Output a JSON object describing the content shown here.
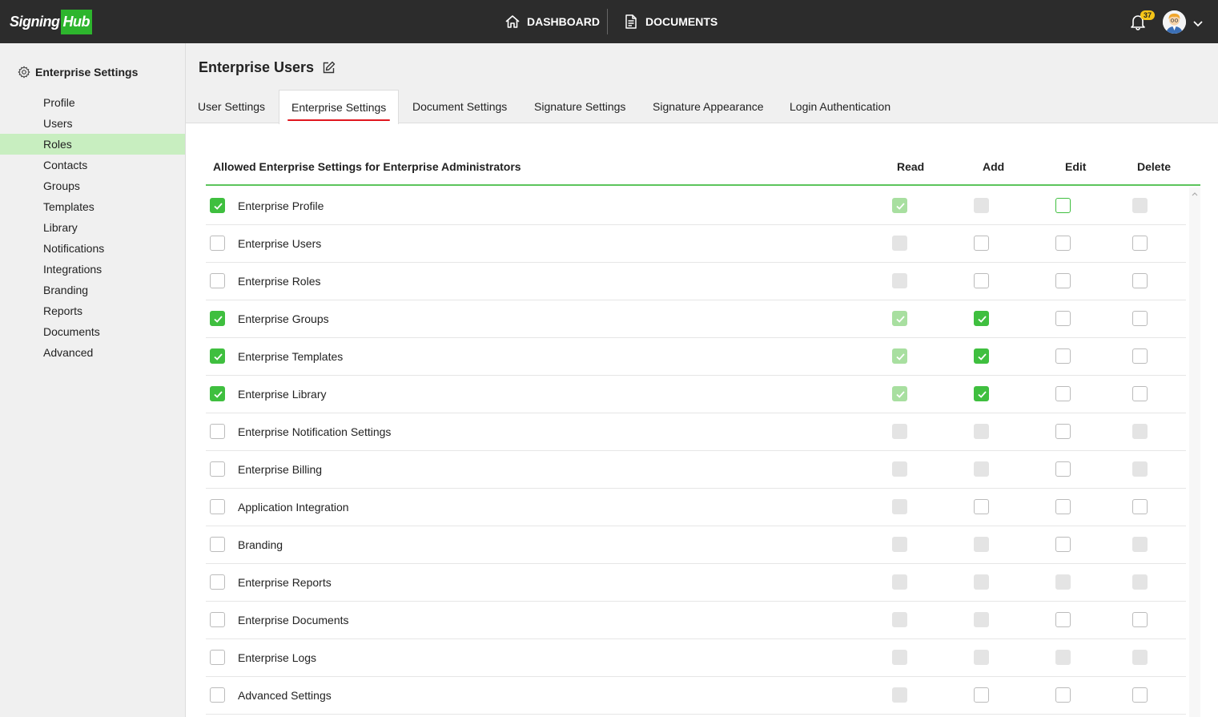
{
  "app": {
    "logo_part1": "Signing",
    "logo_part2": "Hub",
    "nav_dashboard": "DASHBOARD",
    "nav_documents": "DOCUMENTS",
    "notification_count": "37",
    "brand_color": "#2db52d"
  },
  "sidebar": {
    "title": "Enterprise Settings",
    "items": [
      {
        "label": "Profile",
        "active": false
      },
      {
        "label": "Users",
        "active": false
      },
      {
        "label": "Roles",
        "active": true
      },
      {
        "label": "Contacts",
        "active": false
      },
      {
        "label": "Groups",
        "active": false
      },
      {
        "label": "Templates",
        "active": false
      },
      {
        "label": "Library",
        "active": false
      },
      {
        "label": "Notifications",
        "active": false
      },
      {
        "label": "Integrations",
        "active": false
      },
      {
        "label": "Branding",
        "active": false
      },
      {
        "label": "Reports",
        "active": false
      },
      {
        "label": "Documents",
        "active": false
      },
      {
        "label": "Advanced",
        "active": false
      }
    ]
  },
  "main": {
    "page_title": "Enterprise Users",
    "tabs": [
      {
        "label": "User Settings",
        "active": false
      },
      {
        "label": "Enterprise Settings",
        "active": true
      },
      {
        "label": "Document Settings",
        "active": false
      },
      {
        "label": "Signature Settings",
        "active": false
      },
      {
        "label": "Signature Appearance",
        "active": false
      },
      {
        "label": "Login Authentication",
        "active": false
      }
    ]
  },
  "table": {
    "headers": {
      "name": "Allowed Enterprise Settings for Enterprise Administrators",
      "read": "Read",
      "add": "Add",
      "edit": "Edit",
      "delete": "Delete"
    },
    "rows": [
      {
        "label": "Enterprise Profile",
        "allowed": "on",
        "read": "onlight",
        "add": "dis",
        "edit": "focus",
        "delete": "dis"
      },
      {
        "label": "Enterprise Users",
        "allowed": "off",
        "read": "dis",
        "add": "off",
        "edit": "off",
        "delete": "off"
      },
      {
        "label": "Enterprise Roles",
        "allowed": "off",
        "read": "dis",
        "add": "off",
        "edit": "off",
        "delete": "off"
      },
      {
        "label": "Enterprise Groups",
        "allowed": "on",
        "read": "onlight",
        "add": "on",
        "edit": "off",
        "delete": "off"
      },
      {
        "label": "Enterprise Templates",
        "allowed": "on",
        "read": "onlight",
        "add": "on",
        "edit": "off",
        "delete": "off"
      },
      {
        "label": "Enterprise Library",
        "allowed": "on",
        "read": "onlight",
        "add": "on",
        "edit": "off",
        "delete": "off"
      },
      {
        "label": "Enterprise Notification Settings",
        "allowed": "off",
        "read": "dis",
        "add": "dis",
        "edit": "off",
        "delete": "dis"
      },
      {
        "label": "Enterprise Billing",
        "allowed": "off",
        "read": "dis",
        "add": "dis",
        "edit": "off",
        "delete": "dis"
      },
      {
        "label": "Application Integration",
        "allowed": "off",
        "read": "dis",
        "add": "off",
        "edit": "off",
        "delete": "off"
      },
      {
        "label": "Branding",
        "allowed": "off",
        "read": "dis",
        "add": "dis",
        "edit": "off",
        "delete": "dis"
      },
      {
        "label": "Enterprise Reports",
        "allowed": "off",
        "read": "dis",
        "add": "dis",
        "edit": "dis",
        "delete": "dis"
      },
      {
        "label": "Enterprise Documents",
        "allowed": "off",
        "read": "dis",
        "add": "dis",
        "edit": "off",
        "delete": "off"
      },
      {
        "label": "Enterprise Logs",
        "allowed": "off",
        "read": "dis",
        "add": "dis",
        "edit": "dis",
        "delete": "dis"
      },
      {
        "label": "Advanced Settings",
        "allowed": "off",
        "read": "dis",
        "add": "off",
        "edit": "off",
        "delete": "off"
      }
    ]
  }
}
